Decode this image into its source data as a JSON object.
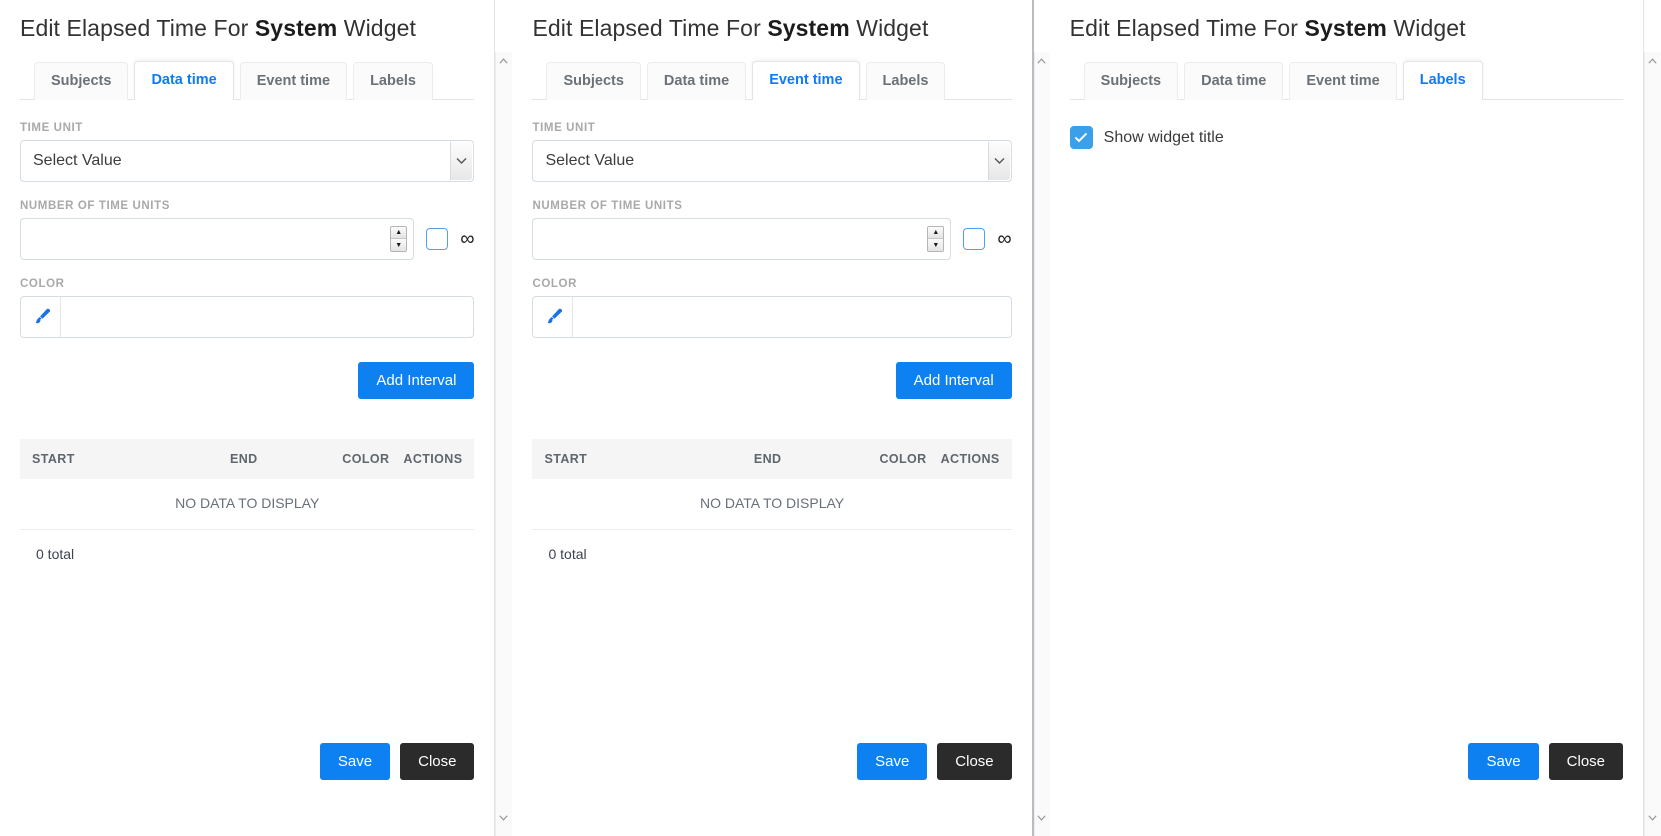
{
  "dialog": {
    "title_prefix": "Edit Elapsed Time For ",
    "title_bold": "System",
    "title_suffix": " Widget"
  },
  "tabs": [
    {
      "label": "Subjects"
    },
    {
      "label": "Data time"
    },
    {
      "label": "Event time"
    },
    {
      "label": "Labels"
    }
  ],
  "form": {
    "time_unit_label": "TIME UNIT",
    "time_unit_value": "Select Value",
    "number_label": "NUMBER OF TIME UNITS",
    "number_value": "",
    "number_placeholder": "",
    "infinity_symbol": "∞",
    "color_label": "COLOR",
    "color_value": "",
    "color_placeholder": "",
    "add_interval_label": "Add Interval"
  },
  "table": {
    "columns": [
      "START",
      "END",
      "COLOR",
      "ACTIONS"
    ],
    "empty_text": "NO DATA TO DISPLAY",
    "total_text": "0 total",
    "rows": []
  },
  "labels_tab": {
    "show_widget_title_label": "Show widget title",
    "show_widget_title_checked": true,
    "check_glyph": "✓"
  },
  "footer": {
    "save_label": "Save",
    "close_label": "Close"
  },
  "icons": {
    "chevron_down": "⌄",
    "chevron_up": "⌃",
    "spinner_up": "▲",
    "spinner_down": "▼"
  },
  "colors": {
    "accent_blue": "#0d80f2",
    "tab_active_blue": "#0d7bf5",
    "close_dark": "#2b2b2b",
    "checkbox_blue": "#3aa0ea",
    "brush_blue": "#1a73e8"
  },
  "panels": [
    {
      "active_tab_index": 1
    },
    {
      "active_tab_index": 2
    },
    {
      "active_tab_index": 3
    }
  ]
}
